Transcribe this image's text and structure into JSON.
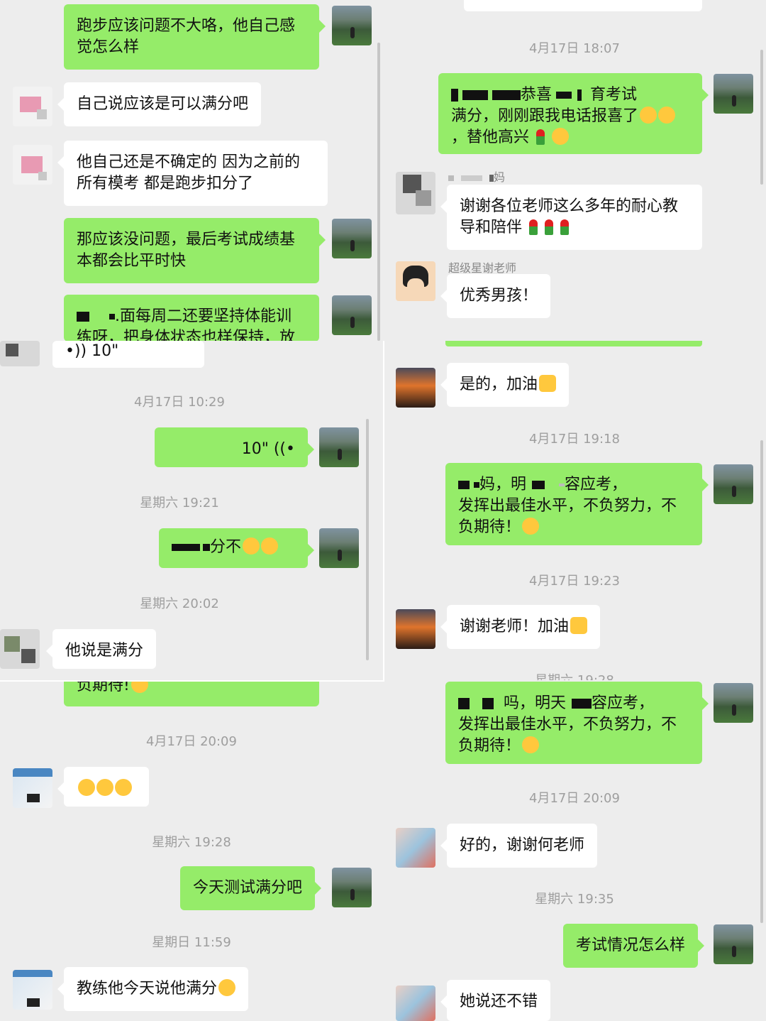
{
  "left_chat": {
    "messages": {
      "m1": "跑步应该问题不大咯，他自己感觉怎么样",
      "m2": "自己说应该是可以满分吧",
      "m3": "他自己还是不确定的 因为之前的所有模考 都是跑步扣分了",
      "m4": "那应该没问题，最后考试成绩基本都会比平时快",
      "m5": ".面每周二还要坚持体能训练呀，把身体状态也样保持，放",
      "m6": "负期待!",
      "m7": "今天测试满分吧",
      "m8": "教练他今天说他满分"
    },
    "times": {
      "t1": "4月17日 20:09",
      "t2": "星期六 19:28",
      "t3": "星期日 11:59"
    }
  },
  "overlay_chat": {
    "voice_in": "10\"",
    "voice_out": "10\"",
    "msg_full": "分不",
    "msg_said": "他说是满分",
    "times": {
      "t1": "4月17日 10:29",
      "t2": "星期六 19:21",
      "t3": "星期六 20:02"
    }
  },
  "right_chat": {
    "times": {
      "t1": "4月17日 18:07",
      "t2": "4月17日 19:18",
      "t3": "4月17日 19:23",
      "t4": "星期六 19:28",
      "t5": "4月17日 20:09",
      "t6": "星期六 19:35"
    },
    "sender_names": {
      "mom": "妈",
      "teacher": "超级星谢老师"
    },
    "messages": {
      "r1_a": "恭喜",
      "r1_b": "育考试",
      "r1_c": "满分，刚刚跟我电话报喜了",
      "r1_d": "，替他高兴",
      "r2": "谢谢各位老师这么多年的耐心教导和陪伴",
      "r3": "优秀男孩！",
      "r4": "是的，加油",
      "r5_a": "妈，明",
      "r5_b": "容应考，",
      "r5_c": "发挥出最佳水平，不负努力，不负期待！",
      "r6": "谢谢老师！加油",
      "r7_a": "吗，明天",
      "r7_b": "容应考，",
      "r7_c": "发挥出最佳水平，不负努力，不负期待！",
      "r8": "好的，谢谢何老师",
      "r9": "考试情况怎么样",
      "r10": "她说还不错"
    }
  }
}
